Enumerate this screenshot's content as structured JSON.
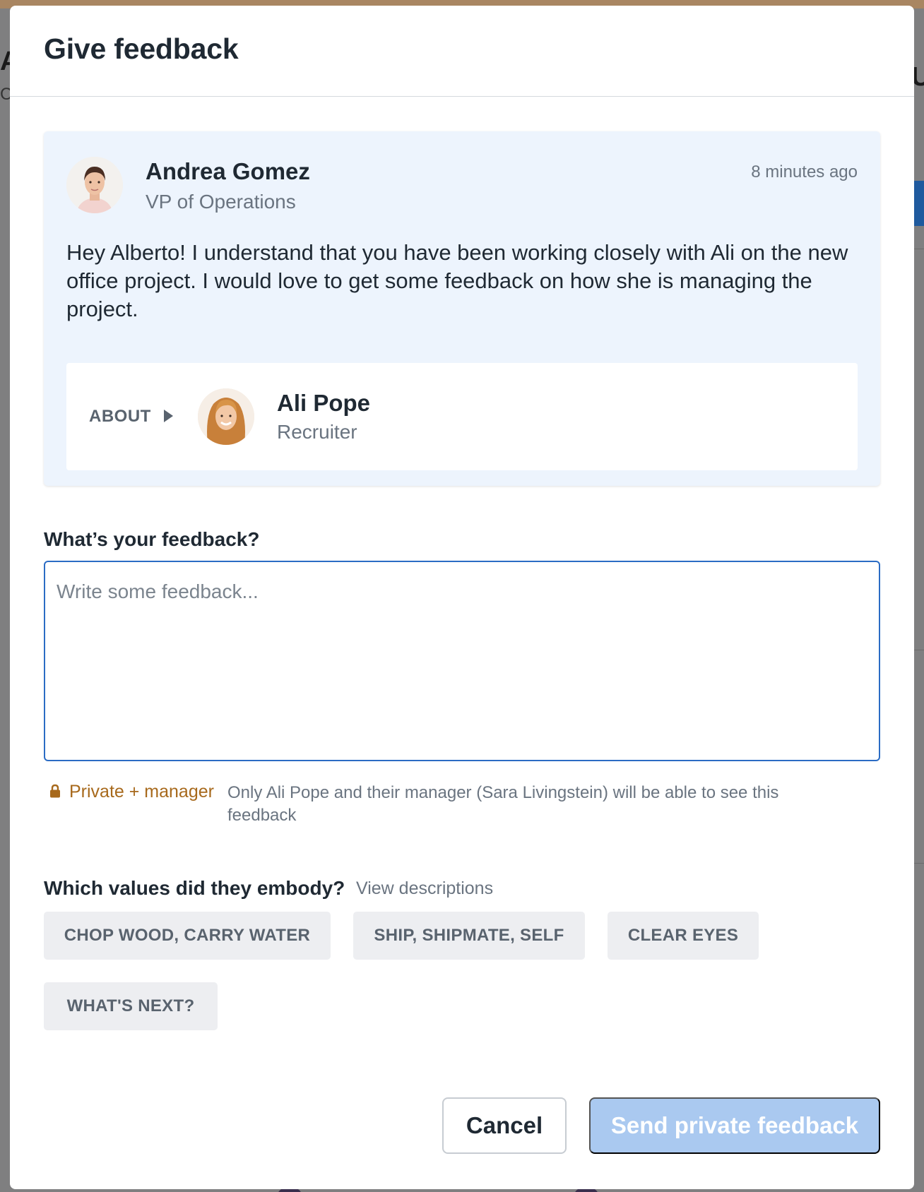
{
  "modal": {
    "title": "Give feedback"
  },
  "request": {
    "requester_name": "Andrea Gomez",
    "requester_role": "VP of Operations",
    "time": "8 minutes ago",
    "message": "Hey Alberto! I understand that you have been working closely with Ali on the new office project. I would love to get some feedback on how she is managing the project.",
    "about_label": "ABOUT",
    "subject_name": "Ali Pope",
    "subject_role": "Recruiter"
  },
  "feedback": {
    "label": "What’s your feedback?",
    "placeholder": "Write some feedback...",
    "value": ""
  },
  "privacy": {
    "icon": "lock-icon",
    "level": "Private + manager",
    "description": "Only Ali Pope and their manager (Sara Livingstein) will be able to see this feedback"
  },
  "values": {
    "label": "Which values did they embody?",
    "link": "View descriptions",
    "chips": [
      "CHOP WOOD, CARRY WATER",
      "SHIP, SHIPMATE, SELF",
      "CLEAR EYES",
      "WHAT'S NEXT?"
    ]
  },
  "actions": {
    "cancel_label": "Cancel",
    "send_label": "Send private feedback"
  },
  "colors": {
    "accent": "#2b6cc4",
    "send_disabled": "#aac9f0",
    "card_bg": "#edf4fd",
    "privacy": "#a7691c"
  }
}
